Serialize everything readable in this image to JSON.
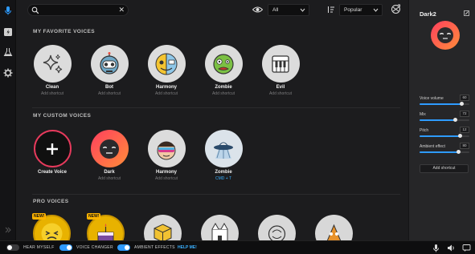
{
  "left_rail": {
    "items": [
      {
        "icon": "microphone-icon",
        "active": true
      },
      {
        "icon": "soundboard-icon",
        "active": false
      },
      {
        "icon": "flask-icon",
        "active": false
      },
      {
        "icon": "gear-icon",
        "active": false
      }
    ],
    "accent": "#2e9bff"
  },
  "topbar": {
    "search": {
      "value": "",
      "placeholder": ""
    },
    "filter_value": "All",
    "sort_value": "Popular"
  },
  "sections": {
    "favorites": {
      "title": "MY FAVORITE VOICES",
      "items": [
        {
          "name": "Clean",
          "shortcut": "Add shortcut",
          "icon": "sparkles-icon"
        },
        {
          "name": "Bot",
          "shortcut": "Add shortcut",
          "icon": "robot-icon"
        },
        {
          "name": "Harmony",
          "shortcut": "Add shortcut",
          "icon": "harmony-icon"
        },
        {
          "name": "Zombie",
          "shortcut": "Add shortcut",
          "icon": "zombie-icon"
        },
        {
          "name": "Evil",
          "shortcut": "Add shortcut",
          "icon": "organ-icon"
        }
      ]
    },
    "custom": {
      "title": "MY CUSTOM VOICES",
      "items": [
        {
          "name": "Create Voice",
          "shortcut": "",
          "icon": "plus-icon"
        },
        {
          "name": "Dark",
          "shortcut": "Add shortcut",
          "icon": "dark-face-icon"
        },
        {
          "name": "Harmony",
          "shortcut": "Add shortcut",
          "icon": "sunglasses-face-icon"
        },
        {
          "name": "Zombie",
          "shortcut": "CMD + T",
          "icon": "ufo-icon"
        }
      ]
    },
    "pro": {
      "title": "PRO VOICES",
      "new_badge": "NEW!"
    }
  },
  "panel": {
    "title": "Dark2",
    "sliders": [
      {
        "label": "Voice volume",
        "value": "60",
        "level": 0.85
      },
      {
        "label": "Mix",
        "value": "72",
        "level": 0.72
      },
      {
        "label": "Pitch",
        "value": "12",
        "level": 0.82
      },
      {
        "label": "Ambient effect",
        "value": "80",
        "level": 0.78
      }
    ],
    "add_shortcut": "Add shortcut"
  },
  "bottombar": {
    "hear_myself": {
      "label": "HEAR MYSELF",
      "on": false
    },
    "voice_changer": {
      "label": "VOICE CHANGER",
      "on": true
    },
    "ambient_effects": {
      "label": "AMBIENT EFFECTS",
      "on": true
    },
    "help": "HELP ME!"
  }
}
